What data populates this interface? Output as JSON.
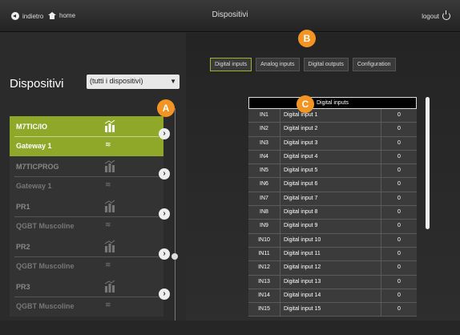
{
  "header": {
    "back_label": "indietro",
    "home_label": "home",
    "title": "Dispositivi",
    "logout_label": "logout"
  },
  "left": {
    "title": "Dispositivi",
    "filter_value": "(tutti i dispositivi)",
    "devices": [
      {
        "name": "M7TIC/IO",
        "gateway": "Gateway 1"
      },
      {
        "name": "M7TICPROG",
        "gateway": "Gateway 1"
      },
      {
        "name": "PR1",
        "gateway": "QGBT Muscoline"
      },
      {
        "name": "PR2",
        "gateway": "QGBT Muscoline"
      },
      {
        "name": "PR3",
        "gateway": "QGBT Muscoline"
      }
    ]
  },
  "tabs": [
    "Digital inputs",
    "Analog inputs",
    "Digital outputs",
    "Configuration"
  ],
  "markers": {
    "a": "A",
    "b": "B",
    "c": "C"
  },
  "table": {
    "header": "Digital inputs",
    "rows": [
      {
        "id": "IN1",
        "name": "Digital input 1",
        "value": "0"
      },
      {
        "id": "IN2",
        "name": "Digital input 2",
        "value": "0"
      },
      {
        "id": "IN3",
        "name": "Digital input 3",
        "value": "0"
      },
      {
        "id": "IN4",
        "name": "Digital input 4",
        "value": "0"
      },
      {
        "id": "IN5",
        "name": "Digital input 5",
        "value": "0"
      },
      {
        "id": "IN6",
        "name": "Digital input 6",
        "value": "0"
      },
      {
        "id": "IN7",
        "name": "Digital input 7",
        "value": "0"
      },
      {
        "id": "IN8",
        "name": "Digital input 8",
        "value": "0"
      },
      {
        "id": "IN9",
        "name": "Digital input 9",
        "value": "0"
      },
      {
        "id": "IN10",
        "name": "Digital input 10",
        "value": "0"
      },
      {
        "id": "IN11",
        "name": "Digital input 11",
        "value": "0"
      },
      {
        "id": "IN12",
        "name": "Digital input 12",
        "value": "0"
      },
      {
        "id": "IN13",
        "name": "Digital input 13",
        "value": "0"
      },
      {
        "id": "IN14",
        "name": "Digital input 14",
        "value": "0"
      },
      {
        "id": "IN15",
        "name": "Digital input 15",
        "value": "0"
      }
    ]
  },
  "colors": {
    "accent": "#8fa82a",
    "marker": "#f39423"
  }
}
